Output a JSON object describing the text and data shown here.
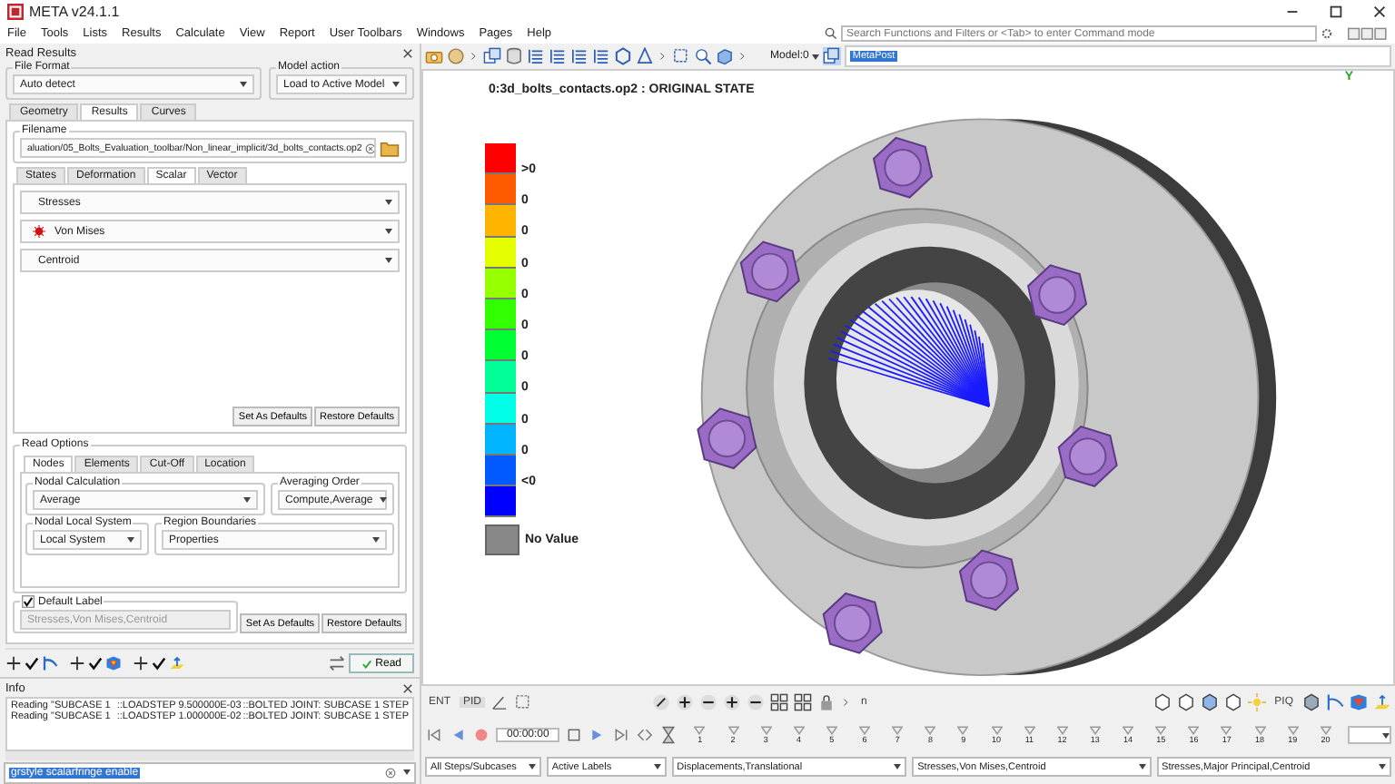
{
  "window": {
    "title": "META v24.1.1"
  },
  "menu": [
    "File",
    "Tools",
    "Lists",
    "Results",
    "Calculate",
    "View",
    "Report",
    "User Toolbars",
    "Windows",
    "Pages",
    "Help"
  ],
  "search": {
    "placeholder": "Search Functions and Filters or <Tab> to enter Command mode"
  },
  "toolbar": {
    "model": "Model:0",
    "name_field": "MetaPost"
  },
  "read_results": {
    "title": "Read Results",
    "file_format": {
      "label": "File Format",
      "value": "Auto detect"
    },
    "model_action": {
      "label": "Model action",
      "value": "Load to Active Model"
    },
    "tabs": [
      {
        "label": "Geometry",
        "selected": false
      },
      {
        "label": "Results",
        "selected": true
      },
      {
        "label": "Curves",
        "selected": false
      }
    ],
    "filename": {
      "label": "Filename",
      "value": "aluation/05_Bolts_Evaluation_toolbar/Non_linear_implicit/3d_bolts_contacts.op2"
    },
    "subtabs": [
      {
        "label": "States",
        "selected": false
      },
      {
        "label": "Deformation",
        "selected": false
      },
      {
        "label": "Scalar",
        "selected": true
      },
      {
        "label": "Vector",
        "selected": false
      }
    ],
    "scalar_selects": [
      {
        "value": "Stresses",
        "marked": false
      },
      {
        "value": "Von Mises",
        "marked": true
      },
      {
        "value": "Centroid",
        "marked": false
      }
    ],
    "buttons": [
      "Set As Defaults",
      "Restore Defaults"
    ],
    "read_options": {
      "title": "Read Options",
      "tabs": [
        {
          "label": "Nodes",
          "selected": true
        },
        {
          "label": "Elements",
          "selected": false
        },
        {
          "label": "Cut-Off",
          "selected": false
        },
        {
          "label": "Location",
          "selected": false
        }
      ],
      "nodal_calculation": {
        "label": "Nodal Calculation",
        "value": "Average"
      },
      "averaging_order": {
        "label": "Averaging Order",
        "value": "Compute,Average"
      },
      "nodal_local_system": {
        "label": "Nodal Local System",
        "value": "Local System"
      },
      "region_boundaries": {
        "label": "Region Boundaries",
        "value": "Properties"
      }
    },
    "default_label": {
      "label": "Default Label",
      "checked": true,
      "disabled": true,
      "value": "Stresses,Von Mises,Centroid"
    },
    "label_buttons": [
      "Set As Defaults",
      "Restore Defaults"
    ],
    "read_button": "Read"
  },
  "info": {
    "title": "Info",
    "lines": [
      [
        "Reading \"SUBCASE 1",
        "::LOADSTEP 9.500000E-03",
        "::BOLTED JOINT: SUBCASE 1 STEP"
      ],
      [
        "Reading \"SUBCASE 1",
        "::LOADSTEP 1.000000E-02",
        "::BOLTED JOINT: SUBCASE 1 STEP"
      ]
    ]
  },
  "command": {
    "value": "grstyle scalarfringe enable"
  },
  "viewport": {
    "title": "0:3d_bolts_contacts.op2  : ORIGINAL STATE",
    "axis_label": "Y",
    "legend": {
      "bands": [
        {
          "color": "#ff0000"
        },
        {
          "color": "#ff5a00"
        },
        {
          "color": "#ffb400"
        },
        {
          "color": "#e6ff00"
        },
        {
          "color": "#96ff00"
        },
        {
          "color": "#32ff00"
        },
        {
          "color": "#00ff32"
        },
        {
          "color": "#00ff96"
        },
        {
          "color": "#00ffe6"
        },
        {
          "color": "#00b4ff"
        },
        {
          "color": "#005aff"
        },
        {
          "color": "#0000ff"
        }
      ],
      "labels": [
        ">0",
        "0",
        "0",
        "0",
        "0",
        "0",
        "0",
        "0",
        "0",
        "0",
        "<0"
      ],
      "no_value": "No Value"
    }
  },
  "bottom": {
    "ent": "ENT",
    "pid": "PID",
    "piq": "PIQ",
    "n": "n",
    "time": "00:00:00",
    "steps": [
      "1",
      "2",
      "3",
      "4",
      "5",
      "6",
      "7",
      "8",
      "9",
      "10",
      "11",
      "12",
      "13",
      "14",
      "15",
      "16",
      "17",
      "18",
      "19",
      "20"
    ],
    "selects": [
      "All Steps/Subcases",
      "Active Labels",
      "Displacements,Translational",
      "Stresses,Von Mises,Centroid",
      "Stresses,Major Principal,Centroid"
    ]
  }
}
